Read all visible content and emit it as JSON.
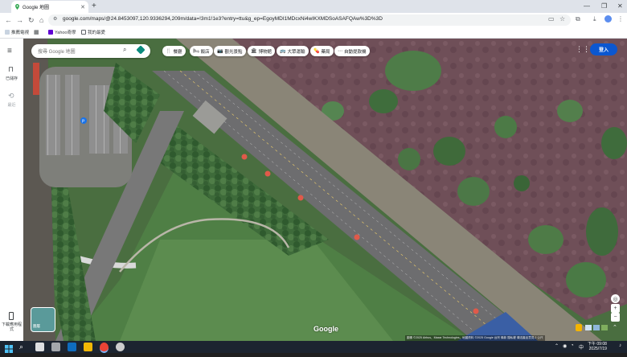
{
  "browser": {
    "tab_title": "Google 地圖",
    "new_tab": "+",
    "url": "google.com/maps/@24.8453097,120.9336294,209m/data=!3m1!1e3?entry=ttu&g_ep=EgoyMDI1MDcxNi4wIKXMDSoASAFQAw%3D%3D",
    "bookmarks": [
      {
        "label": "推薦電視"
      },
      {
        "label": "Yahoo奇摩"
      },
      {
        "label": "我的最愛"
      }
    ]
  },
  "left_nav": {
    "saved_label": "已儲存",
    "recent_label": "最近",
    "download_app_label": "下載應用程式"
  },
  "map": {
    "search_placeholder": "搜尋 Google 地圖",
    "chips": [
      {
        "icon": "🍴",
        "label": "餐廳"
      },
      {
        "icon": "🛏",
        "label": "飯店"
      },
      {
        "icon": "📷",
        "label": "觀光景點"
      },
      {
        "icon": "🏛",
        "label": "博物館"
      },
      {
        "icon": "🚌",
        "label": "大眾運輸"
      },
      {
        "icon": "💊",
        "label": "藥局"
      },
      {
        "icon": "⋯",
        "label": "自動提款機"
      }
    ],
    "signin_label": "登入",
    "layers_label": "圖層",
    "google_logo": "Google",
    "attribution": "圖像 ©2025 Airbus、Maxar Technologies，地圖資料 ©2025 Google  台灣  條款  隱私權  傳送產品意見  2 公尺"
  },
  "taskbar": {
    "time": "下午 09:08",
    "date": "2025/7/19",
    "lang": "中"
  },
  "colors": {
    "accent": "#0b57d0",
    "taskbar": "#1c2430"
  }
}
